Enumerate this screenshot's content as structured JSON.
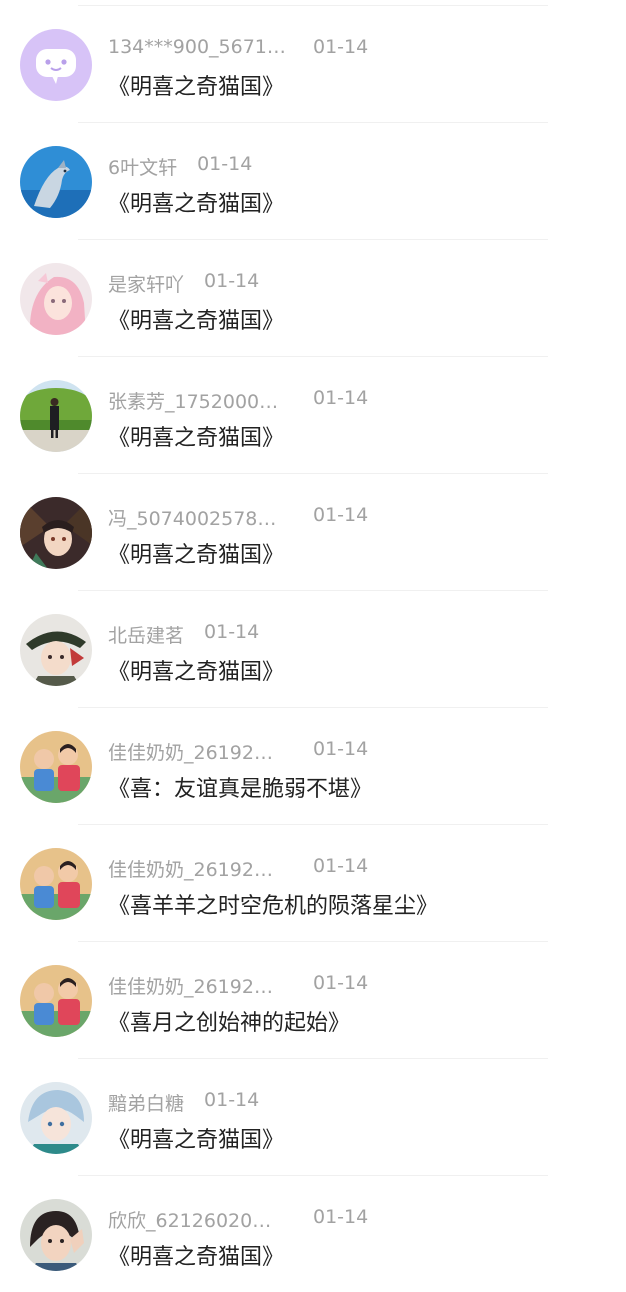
{
  "items": [
    {
      "name": "134***900_5671…",
      "date": "01-14",
      "book": "《明喜之奇猫国》",
      "avatar": "chat-bubble-avatar"
    },
    {
      "name": "6叶文轩",
      "date": "01-14",
      "book": "《明喜之奇猫国》",
      "avatar": "dolphin-avatar"
    },
    {
      "name": "是家轩吖",
      "date": "01-14",
      "book": "《明喜之奇猫国》",
      "avatar": "anime-girl-avatar"
    },
    {
      "name": "张素芳_1752000…",
      "date": "01-14",
      "book": "《明喜之奇猫国》",
      "avatar": "person-outdoor-avatar"
    },
    {
      "name": "冯_5074002578…",
      "date": "01-14",
      "book": "《明喜之奇猫国》",
      "avatar": "anime-character-avatar"
    },
    {
      "name": "北岳建茗",
      "date": "01-14",
      "book": "《明喜之奇猫国》",
      "avatar": "anime-warrior-avatar"
    },
    {
      "name": "佳佳奶奶_26192…",
      "date": "01-14",
      "book": "《喜：友谊真是脆弱不堪》",
      "avatar": "kids-photo-avatar"
    },
    {
      "name": "佳佳奶奶_26192…",
      "date": "01-14",
      "book": "《喜羊羊之时空危机的陨落星尘》",
      "avatar": "kids-photo-avatar"
    },
    {
      "name": "佳佳奶奶_26192…",
      "date": "01-14",
      "book": "《喜月之创始神的起始》",
      "avatar": "kids-photo-avatar"
    },
    {
      "name": "黯弟白糖",
      "date": "01-14",
      "book": "《明喜之奇猫国》",
      "avatar": "anime-boy-avatar"
    },
    {
      "name": "欣欣_62126020…",
      "date": "01-14",
      "book": "《明喜之奇猫国》",
      "avatar": "girl-selfie-avatar"
    }
  ]
}
